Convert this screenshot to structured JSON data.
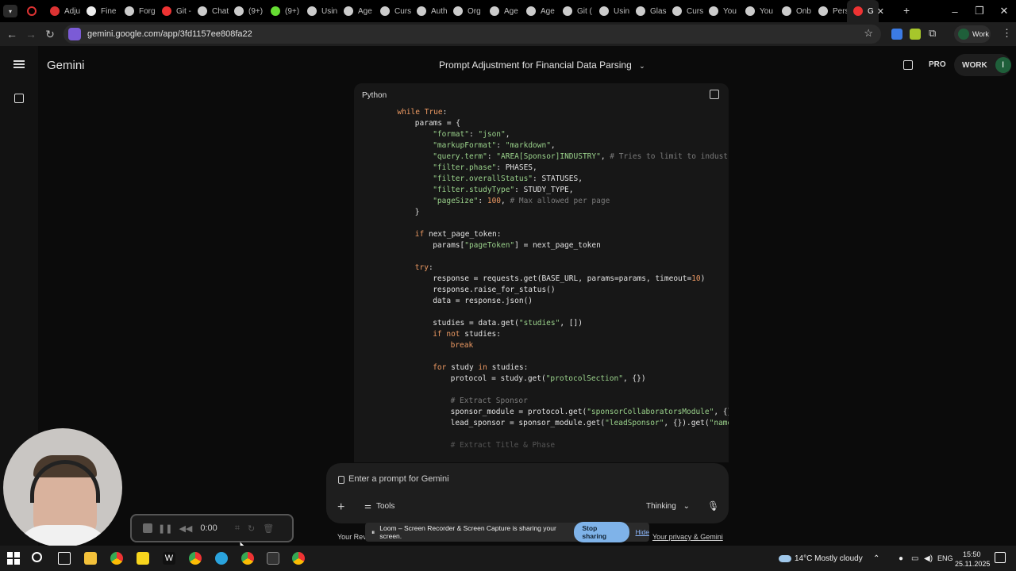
{
  "tabs": [
    {
      "label": "Adju",
      "color": "#d33"
    },
    {
      "label": "Fine",
      "color": "#eee"
    },
    {
      "label": "Forg",
      "color": "#ccc"
    },
    {
      "label": "Git -",
      "color": "#e33"
    },
    {
      "label": "Chat",
      "color": "#ccc"
    },
    {
      "label": "(9+)",
      "color": "#ccc"
    },
    {
      "label": "(9+)",
      "color": "#6d3"
    },
    {
      "label": "Usin",
      "color": "#ccc"
    },
    {
      "label": "Age",
      "color": "#ccc"
    },
    {
      "label": "Curs",
      "color": "#ccc"
    },
    {
      "label": "Auth",
      "color": "#ccc"
    },
    {
      "label": "Org",
      "color": "#ccc"
    },
    {
      "label": "Age",
      "color": "#ccc"
    },
    {
      "label": "Age",
      "color": "#ccc"
    },
    {
      "label": "Git (",
      "color": "#ccc"
    },
    {
      "label": "Usin",
      "color": "#ccc"
    },
    {
      "label": "Glas",
      "color": "#ccc"
    },
    {
      "label": "Curs",
      "color": "#ccc"
    },
    {
      "label": "You",
      "color": "#ccc"
    },
    {
      "label": "You",
      "color": "#ccc"
    },
    {
      "label": "Onb",
      "color": "#ccc"
    },
    {
      "label": "Pers",
      "color": "#ccc"
    },
    {
      "label": "G",
      "color": "#e33"
    }
  ],
  "address": {
    "url": "gemini.google.com/app/3fd1157ee808fa22",
    "profile": "Work"
  },
  "app": {
    "name": "Gemini",
    "conversation_title": "Prompt Adjustment for Financial Data Parsing",
    "pro_label": "PRO",
    "work_label": "WORK",
    "avatar_letter": "I"
  },
  "code": {
    "language": "Python",
    "lines": [
      {
        "indent": 2,
        "html": "<span class=\"kw\">while</span> <span class=\"kw\">True</span>:"
      },
      {
        "indent": 4,
        "html": "params = {"
      },
      {
        "indent": 6,
        "html": "<span class=\"str\">\"format\"</span>: <span class=\"str\">\"json\"</span>,"
      },
      {
        "indent": 6,
        "html": "<span class=\"str\">\"markupFormat\"</span>: <span class=\"str\">\"markdown\"</span>,"
      },
      {
        "indent": 6,
        "html": "<span class=\"str\">\"query.term\"</span>: <span class=\"str\">\"AREA[Sponsor]INDUSTRY\"</span>, <span class=\"cmt\"># Tries to limit to industry spo</span>"
      },
      {
        "indent": 6,
        "html": "<span class=\"str\">\"filter.phase\"</span>: PHASES,"
      },
      {
        "indent": 6,
        "html": "<span class=\"str\">\"filter.overallStatus\"</span>: STATUSES,"
      },
      {
        "indent": 6,
        "html": "<span class=\"str\">\"filter.studyType\"</span>: STUDY_TYPE,"
      },
      {
        "indent": 6,
        "html": "<span class=\"str\">\"pageSize\"</span>: <span class=\"num\">100</span>, <span class=\"cmt\"># Max allowed per page</span>"
      },
      {
        "indent": 4,
        "html": "}"
      },
      {
        "indent": 0,
        "html": ""
      },
      {
        "indent": 4,
        "html": "<span class=\"kw\">if</span> next_page_token:"
      },
      {
        "indent": 6,
        "html": "params[<span class=\"str\">\"pageToken\"</span>] = next_page_token"
      },
      {
        "indent": 0,
        "html": ""
      },
      {
        "indent": 4,
        "html": "<span class=\"kw\">try</span>:"
      },
      {
        "indent": 6,
        "html": "response = requests.get(BASE_URL, params=params, timeout=<span class=\"num\">10</span>)"
      },
      {
        "indent": 6,
        "html": "response.raise_for_status()"
      },
      {
        "indent": 6,
        "html": "data = response.json()"
      },
      {
        "indent": 0,
        "html": ""
      },
      {
        "indent": 6,
        "html": "studies = data.get(<span class=\"str\">\"studies\"</span>, [])"
      },
      {
        "indent": 6,
        "html": "<span class=\"kw\">if not</span> studies:"
      },
      {
        "indent": 8,
        "html": "<span class=\"kw\">break</span>"
      },
      {
        "indent": 0,
        "html": ""
      },
      {
        "indent": 6,
        "html": "<span class=\"kw\">for</span> study <span class=\"kw\">in</span> studies:"
      },
      {
        "indent": 8,
        "html": "protocol = study.get(<span class=\"str\">\"protocolSection\"</span>, {})"
      },
      {
        "indent": 0,
        "html": ""
      },
      {
        "indent": 8,
        "html": "<span class=\"cmt\"># Extract Sponsor</span>"
      },
      {
        "indent": 8,
        "html": "sponsor_module = protocol.get(<span class=\"str\">\"sponsorCollaboratorsModule\"</span>, {})"
      },
      {
        "indent": 8,
        "html": "lead_sponsor = sponsor_module.get(<span class=\"str\">\"leadSponsor\"</span>, {}).get(<span class=\"str\">\"name\"</span>, <span class=\"str\">\"U</span>"
      },
      {
        "indent": 0,
        "html": ""
      },
      {
        "indent": 8,
        "html": "<span class=\"fadeline\"># Extract Title & Phase</span>"
      }
    ]
  },
  "prompt": {
    "placeholder": "Enter a prompt for Gemini",
    "tools": "Tools",
    "mode": "Thinking"
  },
  "footer": {
    "left": "Your Reve",
    "right": "Your privacy & Gemini"
  },
  "loom": {
    "message": "Loom – Screen Recorder & Screen Capture is sharing your screen.",
    "stop": "Stop sharing",
    "hide": "Hide"
  },
  "recorder": {
    "time": "0:00"
  },
  "taskbar": {
    "weather": "14°C  Mostly cloudy",
    "lang": "ENG",
    "time": "15:50",
    "date": "25.11.2025"
  }
}
